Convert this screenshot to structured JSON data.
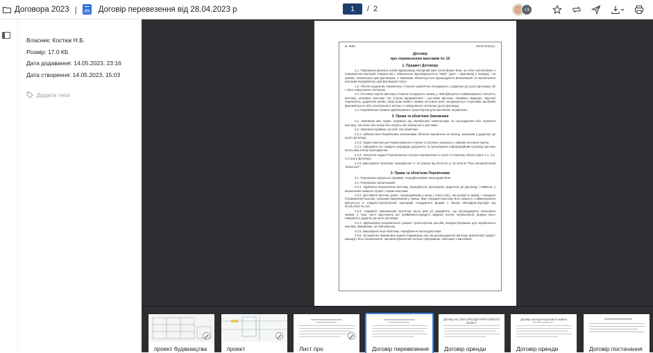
{
  "header": {
    "folder": "Договора 2023",
    "separator": "|",
    "docs_badge": "docs",
    "document_title": "Договір перевезення від 28.04.2023 р",
    "page_current": "1",
    "page_separator": "/",
    "page_total": "2",
    "avatar_extra": "+3"
  },
  "info": {
    "owner": "Власник: Костюк Н.Б.",
    "size": "Розмір: 17.0 КБ",
    "date_added": "Дата додавання: 14.05.2023, 23:16",
    "date_created": "Дата створення: 14.05.2023, 15:03",
    "add_tags": "Додати теги"
  },
  "document": {
    "city": "м. Київ",
    "date": "28.04.2023 р.",
    "title_line1": "Договір",
    "title_line2": "про перевезення вантажів № 15",
    "sections": [
      {
        "title": "1. Предмет Договору",
        "paragraphs": [
          "1.1. Перевізник фізична особа-підприємець Мотурний Іван Олексійович бере на себе зобов'язання з перевезення вантажів Товариства з обмеженою відповідальністю \"Мрія\" (далі – Замовник) у порядку і на умовах, визначених цим Договором, а Замовник зобов'язується відшкодувати Виконавцеві за перевезення вантажів передбачену цим Договором плату.",
          "1.2. Обсяги щоденних перевезень Сторони щомісячно погоджують у додатках до цього Договору, які є його невід'ємною частиною.",
          "1.3. На кожну партію вантажу Сторони погоджують заявку, у якій фіксуються найменування і кількість вантажу, упаковка вантажу, час (строк) відправлення і доставки вантажу, напрями, маршрут, відстані перевезень, додаткові умови, якщо вони наявні. Заявки на кожен рейс погоджуються сторонами засобами факсимільного або електронного зв'язку і є невід'ємною частиною цього Договору.",
          "1.4. Перевезення повинні здійснюватися транспортом для вантажних перевезень."
        ]
      },
      {
        "title": "2. Права та обов'язки Замовника",
        "paragraphs": [
          "2.1. Замовник має право отримати від перевізника компенсацію за пошкодження або псування вантажу, частково або повну його втрату або невчасність доставки.",
          "2.2. Замовник приймає на себе такі обов'язки:",
          "2.2.1. Забезпечити Перевізника заплановим обсягом перевезень на місяць, указаним у додатках до цього Договору.",
          "2.2.2. Надати вантаж для навантаження в строки та обсягах, указаних у заявках на кожну партію.",
          "2.2.3. Оформити всі товарно-супровідні документи та організувати інформаційний супровід вантажу на всьому шляху проходження.",
          "2.2.4. Оплатити надані Перевізником послуги перевезення в строк і в повному обсязі згідно з п. 4.1, 4.2 цього Договору.",
          "2.2.5. Виконувати обов'язки, передбачені ст. 51 Закону від 05.04.01 р. № 2344-III \"Про автомобільний транспорт\"."
        ]
      },
      {
        "title": "3. Права та обов'язки Перевізника",
        "paragraphs": [
          "3.1. Перевізник керуються правами, передбаченими законодавством.",
          "3.2. Перевізник зобов'язаний:",
          "3.2.1. Здійснити перевезення вантажу, передбачене Договором, додатком до Договору і заявкою, у визначений заявкою термін і своїми коштами.",
          "3.2.2. Доставити вантаж цілим і неушкодженим у місце і строк (час), які указані в заявці, і передати Отримувачеві вантаж, указаний Замовником у заявці. Факт передачі вантажу, його кількість і найменування фіксується в товарно-транспортній накладній стандартної форми з наказу Мінінфраструктури від 03.06.2019 № 413.",
          "3.2.3. Надавати Замовникові протягом трьох днів усі документи, що підтверджують виконання заявки, у тому числі підготувати акт приймання-передачі наданих послуг перевезення, форма якого наведена у додатку до цього договору.",
          "3.2.4. Здійснювати направлення і ремонт транспортних засобів, використовуваних для перевезення вантажу Замовника, за свій рахунок.",
          "3.2.5. Виконувати інші обов'язки, передбачені законодавством.",
          "3.2.6. За вимогою Замовника надати інформацію про місцезнаходження вантажу, фактичний графік і маршрут його перевезення, причини відхилення за іншу інформацію, пов'язану з вантажем."
        ]
      }
    ]
  },
  "thumbnails": [
    {
      "label": "проект будівництва",
      "active": false,
      "signed": true
    },
    {
      "label": "проект",
      "active": false,
      "signed": true
    },
    {
      "label": "Лист про",
      "active": false,
      "signed": true
    },
    {
      "label": "Договір перевезення",
      "active": true,
      "signed": false
    },
    {
      "label": "Договір оренди",
      "active": false,
      "signed": false
    },
    {
      "label": "Договір оренди",
      "active": false,
      "signed": false
    },
    {
      "label": "Договір постачання",
      "active": false,
      "signed": false
    }
  ],
  "thumb_captions": {
    "t4": "Договір № 1/256 ОРЕНДИ НЕРУХОМОГО МАЙНА",
    "t5": "Договір оренди нерухомого майна"
  },
  "colors": {
    "viewer_bg": "#2c2e31",
    "accent": "#3b86e0",
    "page_input_bg": "#1d3f6e",
    "docs_badge": "#2f73d8"
  },
  "icons": {
    "folder": "folder-icon",
    "docs": "docs-badge-icon",
    "star": "star-icon",
    "sync": "sync-icon",
    "send": "send-icon",
    "download": "download-icon",
    "print": "print-icon",
    "panel": "panel-toggle-icon",
    "tag": "tag-icon",
    "sign": "signature-icon"
  }
}
